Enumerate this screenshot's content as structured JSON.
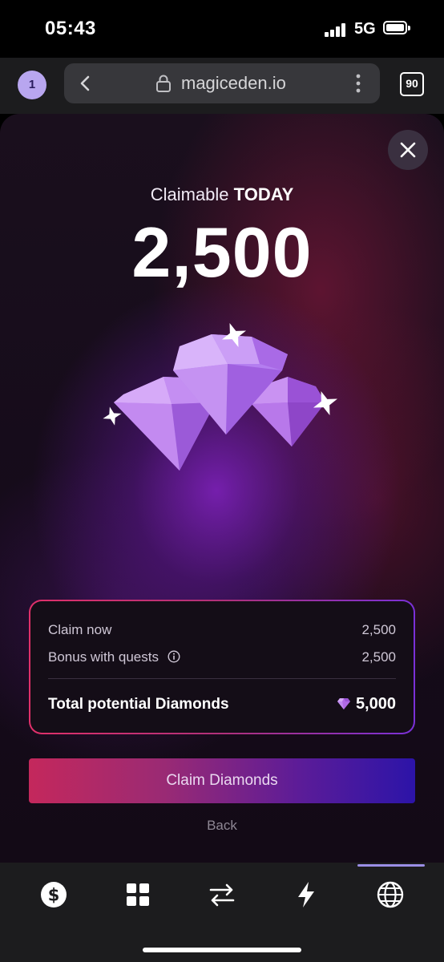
{
  "status_bar": {
    "time": "05:43",
    "network": "5G"
  },
  "browser": {
    "tab_badge": "1",
    "url": "magiceden.io",
    "tab_count": "90"
  },
  "modal": {
    "title_prefix": "Claimable",
    "title_emphasis": "TODAY",
    "amount": "2,500",
    "summary": {
      "claim_now_label": "Claim now",
      "claim_now_value": "2,500",
      "bonus_label": "Bonus with quests",
      "bonus_value": "2,500",
      "total_label": "Total potential Diamonds",
      "total_value": "5,000"
    },
    "claim_button": "Claim Diamonds",
    "back_link": "Back"
  },
  "bottom_nav": {
    "items": [
      {
        "icon": "dollar-icon"
      },
      {
        "icon": "grid-icon"
      },
      {
        "icon": "swap-arrows-icon"
      },
      {
        "icon": "lightning-icon"
      },
      {
        "icon": "globe-icon",
        "active": true
      }
    ]
  },
  "colors": {
    "accent_purple": "#9b8ee6",
    "gradient_pink": "#e0306a",
    "gradient_blue": "#2c14a8"
  }
}
